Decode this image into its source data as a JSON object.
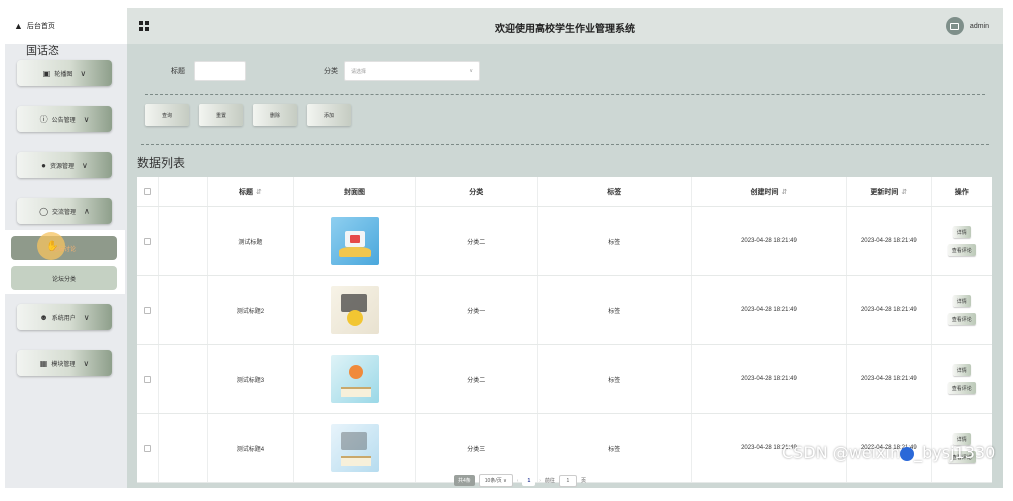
{
  "sidebar": {
    "home_label": "后台首页",
    "watermark_text": "国话恣",
    "menus": [
      {
        "label": "轮播图",
        "icon": "image-icon"
      },
      {
        "label": "公告管理",
        "icon": "info-icon"
      },
      {
        "label": "资源管理",
        "icon": "location-pin-icon"
      },
      {
        "label": "交流管理",
        "icon": "chat-icon"
      },
      {
        "label": "系统用户",
        "icon": "user-icon"
      },
      {
        "label": "模块管理",
        "icon": "grid-icon"
      }
    ],
    "submenu": [
      "论坛讨论",
      "论坛分类"
    ]
  },
  "header": {
    "title": "欢迎使用高校学生作业管理系统",
    "username": "admin"
  },
  "filters": {
    "title_label": "标题",
    "category_label": "分类",
    "category_placeholder": "请选择"
  },
  "actions": {
    "query": "查询",
    "reset": "重置",
    "delete": "删除",
    "add": "添加"
  },
  "list_title": "数据列表",
  "table": {
    "columns": [
      "标题",
      "封面图",
      "分类",
      "标签",
      "创建时间",
      "更新时间",
      "操作"
    ],
    "rows": [
      {
        "title": "测试标题",
        "category": "分类二",
        "tag": "标签",
        "created": "2023-04-28 18:21:49",
        "updated": "2023-04-28 18:21:49"
      },
      {
        "title": "测试标题2",
        "category": "分类一",
        "tag": "标签",
        "created": "2023-04-28 18:21:49",
        "updated": "2023-04-28 18:21:49"
      },
      {
        "title": "测试标题3",
        "category": "分类二",
        "tag": "标签",
        "created": "2023-04-28 18:21:49",
        "updated": "2023-04-28 18:21:49"
      },
      {
        "title": "测试标题4",
        "category": "分类三",
        "tag": "标签",
        "created": "2023-04-28 18:21:49",
        "updated": "2023-04-28 18:21:49"
      }
    ],
    "row_actions": [
      "详情",
      "查看评论"
    ]
  },
  "pagination": {
    "total": "共4条",
    "page_size": "10条/页",
    "current": "1",
    "goto_label": "前往",
    "goto_value": "1",
    "page_suffix": "页"
  },
  "watermark": {
    "prefix": "CSDN @weixin",
    "suffix": "bysj1330"
  },
  "colors": {
    "content_bg": "#cdd7d4",
    "topbar_bg": "#dde3e0",
    "active_item": "#8f9a8b"
  }
}
